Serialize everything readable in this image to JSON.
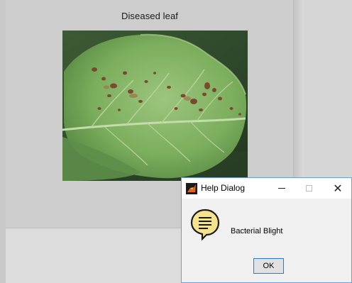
{
  "figure": {
    "title": "Diseased leaf",
    "image": {
      "subject": "diseased-leaf-photo",
      "colors": {
        "background": "#2f4a2c",
        "leaf": "#6fa055",
        "leaf_light": "#9cc57d",
        "vein": "#b6d39a",
        "spot": "#7a4a2f"
      }
    }
  },
  "help_dialog": {
    "title": "Help Dialog",
    "app_icon": "matlab-icon",
    "minimize_icon": "minimize-icon",
    "maximize_icon": "maximize-icon",
    "close_icon": "close-icon",
    "close_glyph": "✕",
    "message_icon": "help-icon",
    "message": "Bacterial Blight",
    "ok_label": "OK",
    "colors": {
      "border": "#6f9fd8",
      "ok_border": "#2b7bd6",
      "help_icon_fill": "#f3e38a"
    }
  }
}
